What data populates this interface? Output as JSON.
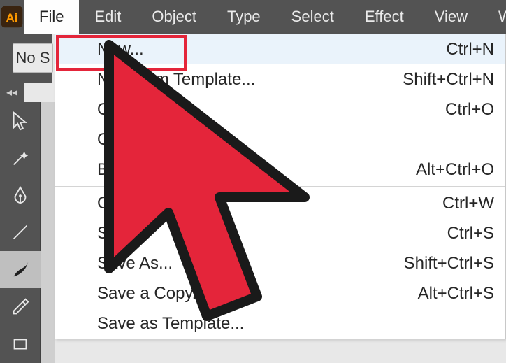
{
  "menubar": {
    "items": [
      "File",
      "Edit",
      "Object",
      "Type",
      "Select",
      "Effect",
      "View",
      "Windo"
    ],
    "active_index": 0
  },
  "options": {
    "label": "No S"
  },
  "tools": [
    {
      "id": "selection",
      "name": "selection-tool-icon"
    },
    {
      "id": "magic",
      "name": "magic-wand-icon"
    },
    {
      "id": "pen",
      "name": "pen-tool-icon"
    },
    {
      "id": "line",
      "name": "line-tool-icon"
    },
    {
      "id": "brush",
      "name": "brush-tool-icon",
      "active": true
    },
    {
      "id": "pencil",
      "name": "pencil-tool-icon"
    },
    {
      "id": "shape",
      "name": "shape-tool-icon"
    }
  ],
  "file_menu": {
    "groups": [
      [
        {
          "label": "New...",
          "shortcut": "Ctrl+N",
          "highlight": true
        },
        {
          "label": "New from Template...",
          "shortcut": "Shift+Ctrl+N"
        },
        {
          "label": "Open...",
          "shortcut": "Ctrl+O"
        },
        {
          "label": "Open Recent Files",
          "shortcut": ""
        },
        {
          "label": "Browse in Bridge...",
          "shortcut": "Alt+Ctrl+O"
        }
      ],
      [
        {
          "label": "Close",
          "shortcut": "Ctrl+W"
        },
        {
          "label": "Save",
          "shortcut": "Ctrl+S"
        },
        {
          "label": "Save As...",
          "shortcut": "Shift+Ctrl+S"
        },
        {
          "label": "Save a Copy...",
          "shortcut": "Alt+Ctrl+S"
        },
        {
          "label": "Save as Template...",
          "shortcut": ""
        }
      ]
    ]
  }
}
